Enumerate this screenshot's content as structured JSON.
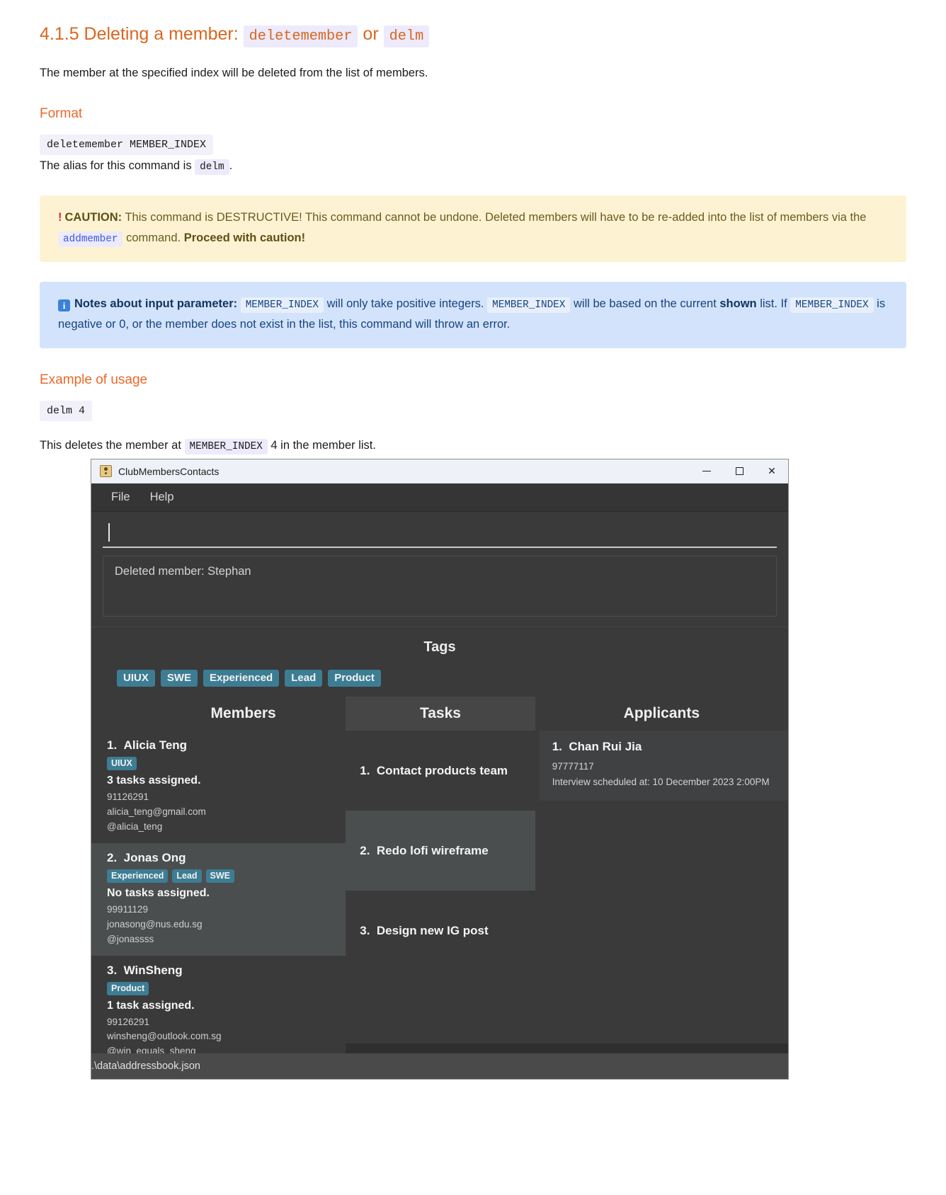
{
  "doc": {
    "section_number_title": "4.1.5 Deleting a member: ",
    "section_cmd_primary": "deletemember",
    "section_or": " or ",
    "section_cmd_alias": "delm",
    "intro": "The member at the specified index will be deleted from the list of members.",
    "format_heading": "Format",
    "format_code": "deletemember MEMBER_INDEX",
    "alias_prefix": "The alias for this command is ",
    "alias_code": "delm",
    "alias_suffix": ".",
    "caution": {
      "bang": "!",
      "label": "CAUTION:",
      "text_1": " This command is DESTRUCTIVE! This command cannot be undone. Deleted members will have to be re-added into the list of members via the ",
      "code": "addmember",
      "text_2": " command. ",
      "bold_tail": "Proceed with caution!"
    },
    "notes": {
      "icon": "i",
      "label": "Notes about input parameter:",
      "code_1": "MEMBER_INDEX",
      "text_1": " will only take positive integers. ",
      "code_2": "MEMBER_INDEX",
      "text_2": " will be based on the current ",
      "bold_shown": "shown",
      "text_3": " list. If ",
      "code_3": "MEMBER_INDEX",
      "text_4": " is negative or 0, or the member does not exist in the list, this command will throw an error."
    },
    "example_heading": "Example of usage",
    "example_code": "delm 4",
    "example_prefix": "This deletes the member at ",
    "example_code_inline": "MEMBER_INDEX",
    "example_suffix": " 4 in the member list."
  },
  "app": {
    "window_title": "ClubMembersContacts",
    "window_icon": "app-user-icon",
    "controls": {
      "minimize": "minimize-icon",
      "maximize": "maximize-icon",
      "close": "✕"
    },
    "menu": [
      {
        "label": "File"
      },
      {
        "label": "Help"
      }
    ],
    "command_input_value": "",
    "result_text": "Deleted member: Stephan",
    "tags_panel": {
      "title": "Tags",
      "tags": [
        "UIUX",
        "SWE",
        "Experienced",
        "Lead",
        "Product"
      ]
    },
    "members_panel": {
      "title": "Members",
      "items": [
        {
          "index": "1.",
          "name": "Alicia Teng",
          "tags": [
            "UIUX"
          ],
          "tasks": "3 tasks assigned.",
          "phone": "91126291",
          "email": "alicia_teng@gmail.com",
          "handle": "@alicia_teng",
          "selected": false
        },
        {
          "index": "2.",
          "name": "Jonas Ong",
          "tags": [
            "Experienced",
            "Lead",
            "SWE"
          ],
          "tasks": "No tasks assigned.",
          "phone": "99911129",
          "email": "jonasong@nus.edu.sg",
          "handle": "@jonassss",
          "selected": true
        },
        {
          "index": "3.",
          "name": "WinSheng",
          "tags": [
            "Product"
          ],
          "tasks": "1 task assigned.",
          "phone": "99126291",
          "email": "winsheng@outlook.com.sg",
          "handle": "@win_equals_sheng",
          "selected": false
        }
      ]
    },
    "tasks_panel": {
      "title": "Tasks",
      "items": [
        {
          "index": "1.",
          "label": "Contact products team"
        },
        {
          "index": "2.",
          "label": "Redo lofi wireframe"
        },
        {
          "index": "3.",
          "label": "Design new IG post"
        }
      ]
    },
    "applicants_panel": {
      "title": "Applicants",
      "items": [
        {
          "index": "1.",
          "name": "Chan Rui Jia",
          "phone": "97777117",
          "interview": "Interview scheduled at: 10 December 2023 2:00PM"
        }
      ]
    },
    "status_bar": ".\\data\\addressbook.json"
  },
  "colors": {
    "heading_orange": "#d9661f",
    "tag_teal": "#3d7d94",
    "caution_bg": "#fdf3d3",
    "notes_bg": "#d3e3fb",
    "app_bg": "#3a3a3a"
  }
}
